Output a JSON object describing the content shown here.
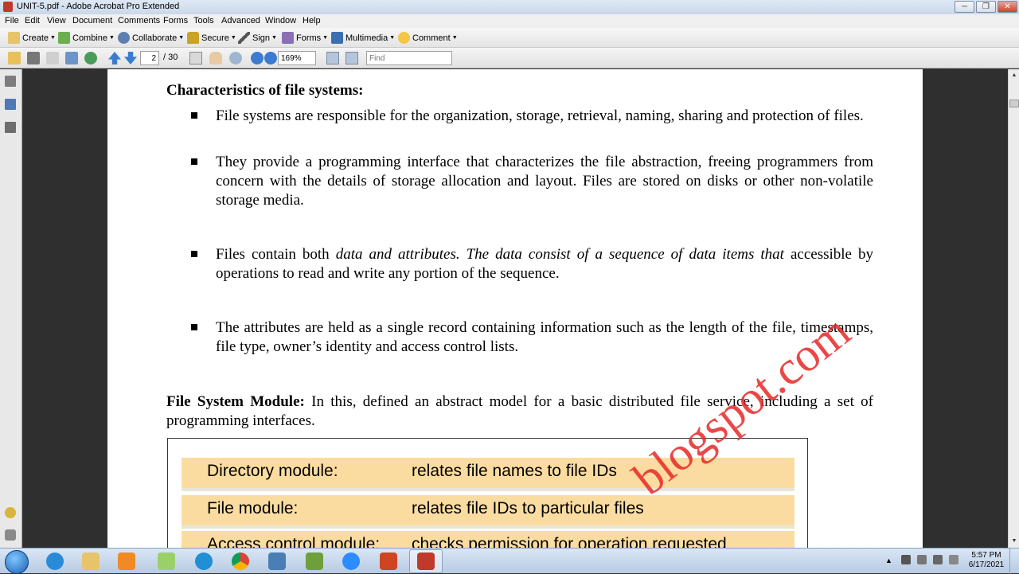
{
  "window": {
    "title": "UNIT-5.pdf - Adobe Acrobat Pro Extended",
    "minimize": "─",
    "restore": "❐",
    "close": "✕"
  },
  "menu": [
    "File",
    "Edit",
    "View",
    "Document",
    "Comments",
    "Forms",
    "Tools",
    "Advanced",
    "Window",
    "Help"
  ],
  "toolbar": {
    "create": "Create",
    "combine": "Combine",
    "collaborate": "Collaborate",
    "secure": "Secure",
    "sign": "Sign",
    "forms": "Forms",
    "multimedia": "Multimedia",
    "comment": "Comment"
  },
  "nav": {
    "page_current": "2",
    "page_total": "/ 30",
    "zoom": "169%",
    "find_placeholder": "Find"
  },
  "document": {
    "heading": "Characteristics of file systems:",
    "bullets": [
      "File systems are responsible for the organization, storage, retrieval, naming, sharing and protection of files.",
      "They provide a programming interface that characterizes the file abstraction, freeing programmers from concern with the details of storage allocation and layout. Files are stored on disks or other non-volatile storage media.",
      "The attributes are held as a single record containing information such as the length of the file, timestamps, file type, owner’s identity and access control lists."
    ],
    "bullet3": {
      "before": "Files contain both ",
      "italic": "data and attributes. The data consist of a sequence of data items that",
      "after": " accessible by operations to read and write any portion of the sequence."
    },
    "fsm_label": "File System Module:",
    "fsm_text": " In this, defined an abstract model for a basic distributed file service, including a set of programming interfaces.",
    "modules": [
      {
        "name": "Directory module:",
        "desc": "relates file names to file IDs"
      },
      {
        "name": "File module:",
        "desc": "relates file IDs to particular files"
      },
      {
        "name": "Access control module:",
        "desc": "checks permission for operation requested"
      }
    ],
    "watermark": "blogspot.com"
  },
  "taskbar": {
    "time": "5:57 PM",
    "date": "6/17/2021"
  },
  "colors": {
    "module_fill": "#fbdca0",
    "watermark": "#e62828"
  }
}
